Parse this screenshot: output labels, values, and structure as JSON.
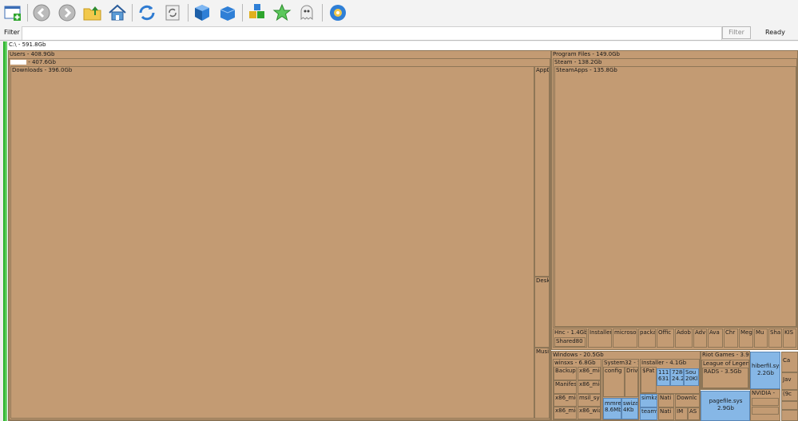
{
  "toolbar": {
    "buttons": [
      {
        "name": "new-scan-icon"
      },
      {
        "name": "back-icon"
      },
      {
        "name": "forward-icon"
      },
      {
        "name": "up-folder-icon"
      },
      {
        "name": "home-icon"
      },
      {
        "name": "refresh-icon"
      },
      {
        "name": "refresh-selected-icon"
      },
      {
        "name": "cube-icon"
      },
      {
        "name": "cube-open-icon"
      },
      {
        "name": "blocks-icon"
      },
      {
        "name": "star-icon"
      },
      {
        "name": "ghost-icon"
      },
      {
        "name": "settings-icon"
      }
    ]
  },
  "filter": {
    "label": "Filter",
    "value": "",
    "button_label": "Filter"
  },
  "status": "Ready",
  "treemap": {
    "root": "C:\\ - 591.8Gb",
    "users": "Users - 408.9Gb",
    "user_size": " - 407.6Gb",
    "downloads": "Downloads - 396.0Gb",
    "appdata": "AppD",
    "desktop": "Desk",
    "music": "Musi",
    "program_files": "Program Files - 149.0Gb",
    "steam": "Steam - 138.2Gb",
    "steamapps": "SteamApps - 135.8Gb",
    "hnc": "Hnc - 1.4Gb",
    "shared80": "Shared80 -",
    "pf_small": [
      "Installer",
      "microso",
      "packa",
      "Offic",
      "Adob",
      "Adv",
      "Ava",
      "Chr",
      "Meg",
      "Mu",
      "Sha",
      "KIS"
    ],
    "windows": "Windows - 20.5Gb",
    "winsxs": "winsxs - 6.8Gb",
    "winsxs_items": [
      "Backup",
      "x86_mic",
      "Manifes",
      "x86_mic",
      "x86_mic",
      "msil_sys",
      "x86_mic",
      "x86_wia"
    ],
    "system32": "System32 - 5",
    "system32_items": [
      "config -",
      "Driv"
    ],
    "mmres": "mmre 8.6Mb",
    "swiza": "swiza 4Kb",
    "installer": "Installer - 4.1Gb",
    "installer_items": [
      "$Pat",
      "1119 631.",
      "728c 24.2",
      "Sou 20Kl"
    ],
    "win_small": [
      "simka",
      "teamv",
      "Nati",
      "Nati",
      "Downlc",
      "IM",
      "AS"
    ],
    "riot": "Riot Games - 3.9G",
    "lol": "League of Legend",
    "rads": "RADS - 3.5Gb",
    "pagefile": "pagefile.sys 2.9Gb",
    "hiberfil": "hiberfil.sys 2.2Gb",
    "nvidia": "NVIDIA -",
    "ca": "Ca",
    "jav": "Jav",
    "misc": "(9c"
  }
}
